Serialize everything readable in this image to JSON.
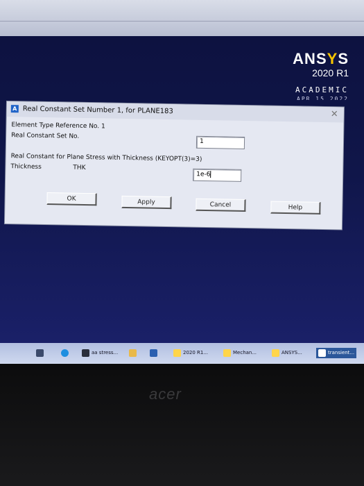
{
  "logo": {
    "brand_pre": "ANS",
    "brand_y": "Y",
    "brand_post": "S",
    "version": "2020 R1",
    "edition": "ACADEMIC",
    "date": "APR 15 2022"
  },
  "dialog": {
    "title": "Real Constant Set Number 1, for PLANE183",
    "element_type_ref": "Element Type Reference No. 1",
    "real_const_set_label": "Real Constant Set No.",
    "real_const_set_value": "1",
    "section_heading": "Real Constant for Plane Stress with Thickness (KEYOPT(3)=3)",
    "thickness_label": "Thickness",
    "thickness_symbol": "THK",
    "thickness_value": "1e-6",
    "buttons": {
      "ok": "OK",
      "apply": "Apply",
      "cancel": "Cancel",
      "help": "Help"
    }
  },
  "taskbar": {
    "items": [
      "aa stress...",
      "2020 R1...",
      "Mechan...",
      "ANSYS...",
      "transient..."
    ]
  },
  "bezel": {
    "brand": "acer"
  },
  "colors": {
    "accent": "#1f63c8",
    "screen_bg": "#10164a",
    "dialog_bg": "#e5e8f2"
  }
}
